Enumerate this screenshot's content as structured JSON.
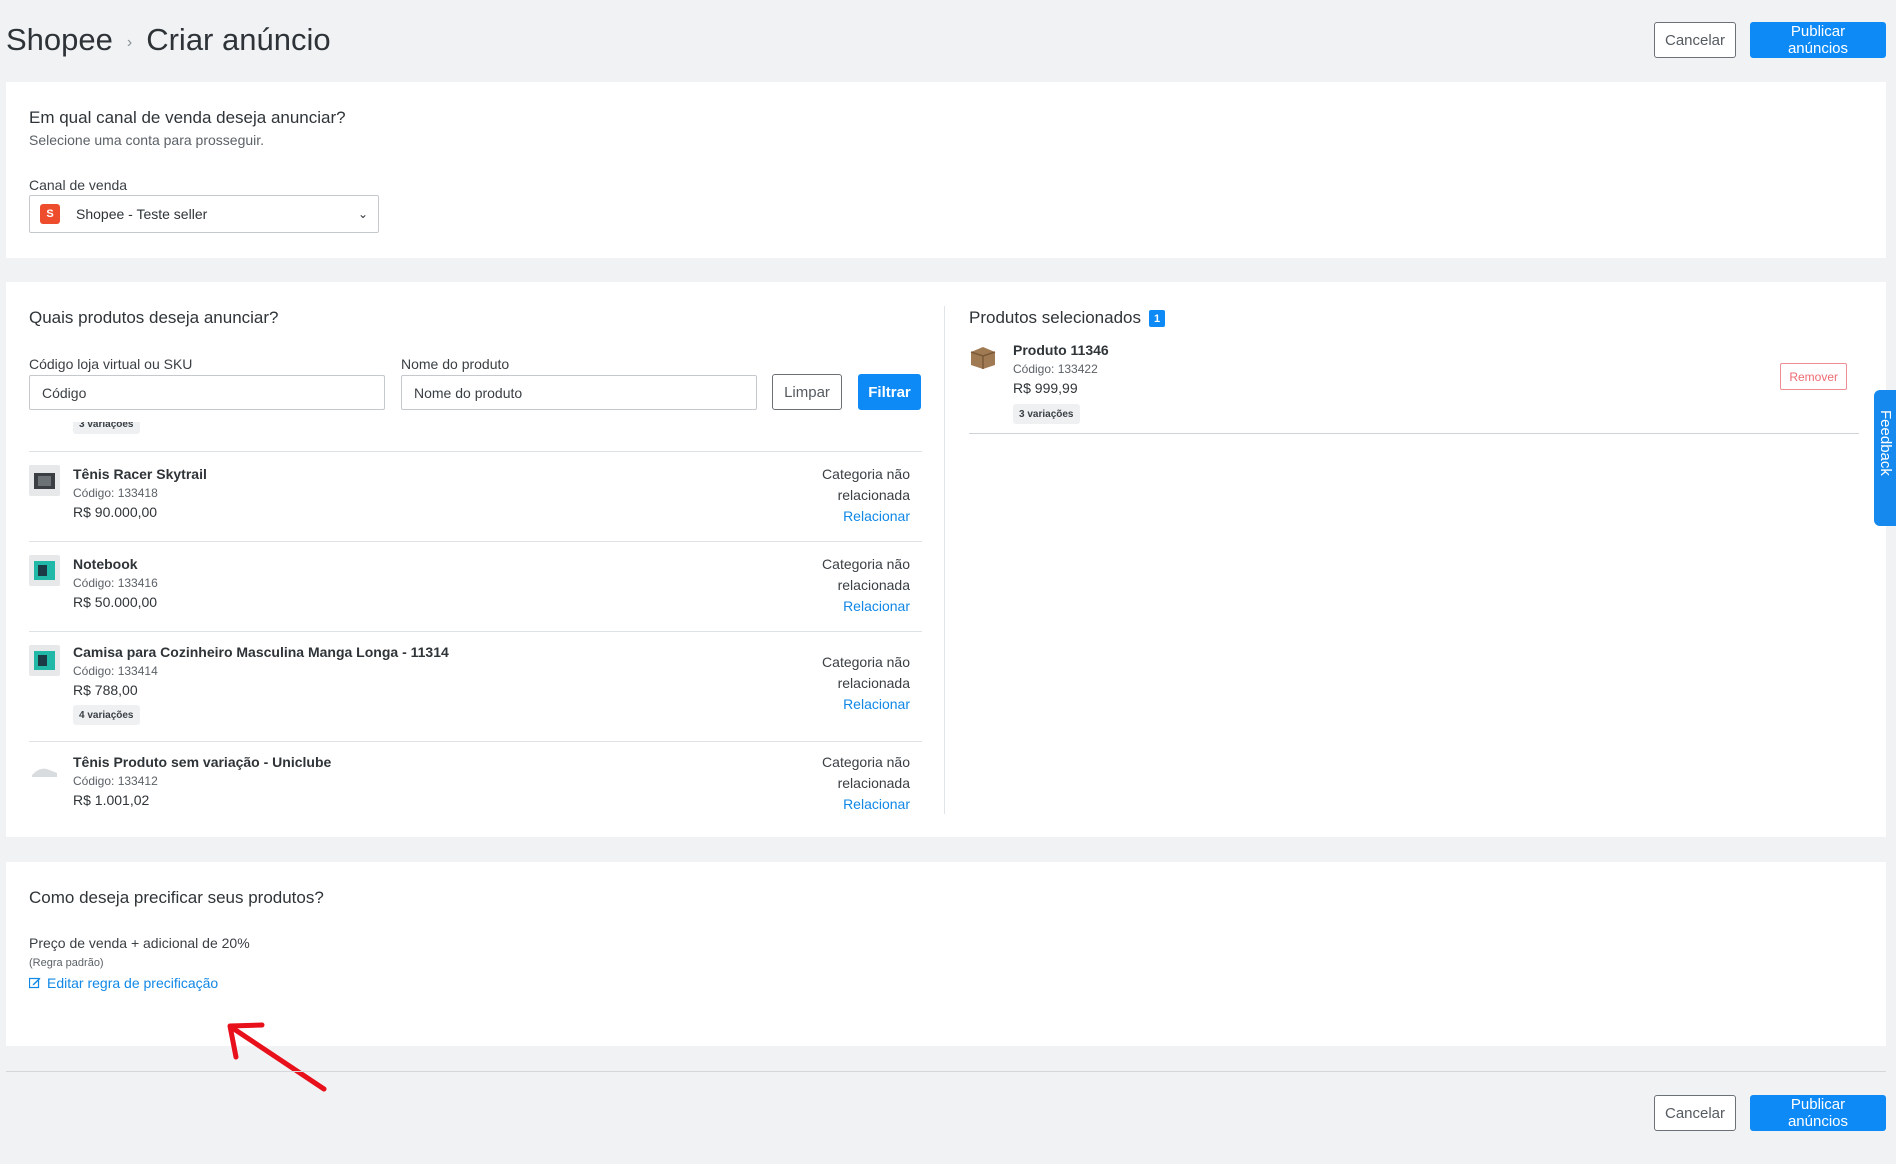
{
  "header": {
    "breadcrumb_root": "Shopee",
    "breadcrumb_current": "Criar anúncio",
    "cancel_label": "Cancelar",
    "publish_label": "Publicar anúncios"
  },
  "channel": {
    "title": "Em qual canal de venda deseja anunciar?",
    "subtitle": "Selecione uma conta para prosseguir.",
    "field_label": "Canal de venda",
    "selected": "Shopee - Teste seller"
  },
  "products": {
    "title": "Quais produtos deseja anunciar?",
    "code_label": "Código loja virtual ou SKU",
    "code_placeholder": "Código",
    "name_label": "Nome do produto",
    "name_placeholder": "Nome do produto",
    "clear_label": "Limpar",
    "filter_label": "Filtrar",
    "partial_badge": "3 variações",
    "items": [
      {
        "name": "Tênis Racer Skytrail",
        "code": "Código: 133418",
        "price": "R$ 90.000,00",
        "cat_line1": "Categoria não",
        "cat_line2": "relacionada",
        "cat_link": "Relacionar"
      },
      {
        "name": "Notebook",
        "code": "Código: 133416",
        "price": "R$ 50.000,00",
        "cat_line1": "Categoria não",
        "cat_line2": "relacionada",
        "cat_link": "Relacionar"
      },
      {
        "name": "Camisa para Cozinheiro Masculina Manga Longa - 11314",
        "code": "Código: 133414",
        "price": "R$ 788,00",
        "badge": "4 variações",
        "cat_line1": "Categoria não",
        "cat_line2": "relacionada",
        "cat_link": "Relacionar"
      },
      {
        "name": "Tênis Produto sem variação - Uniclube",
        "code": "Código: 133412",
        "price": "R$ 1.001,02",
        "cat_line1": "Categoria não",
        "cat_line2": "relacionada",
        "cat_link": "Relacionar"
      }
    ]
  },
  "selected": {
    "title": "Produtos selecionados",
    "count": "1",
    "item": {
      "name": "Produto 11346",
      "code": "Código: 133422",
      "price": "R$ 999,99",
      "badge": "3 variações",
      "remove_label": "Remover"
    }
  },
  "pricing": {
    "title": "Como deseja precificar seus produtos?",
    "rule": "Preço de venda + adicional de 20%",
    "rule_note": "(Regra padrão)",
    "edit_label": "Editar regra de precificação"
  },
  "feedback_label": "Feedback",
  "colors": {
    "primary": "#0d8af5",
    "link": "#1188e6",
    "shopee": "#ee4d2d",
    "annotation_arrow": "#e8101a"
  }
}
